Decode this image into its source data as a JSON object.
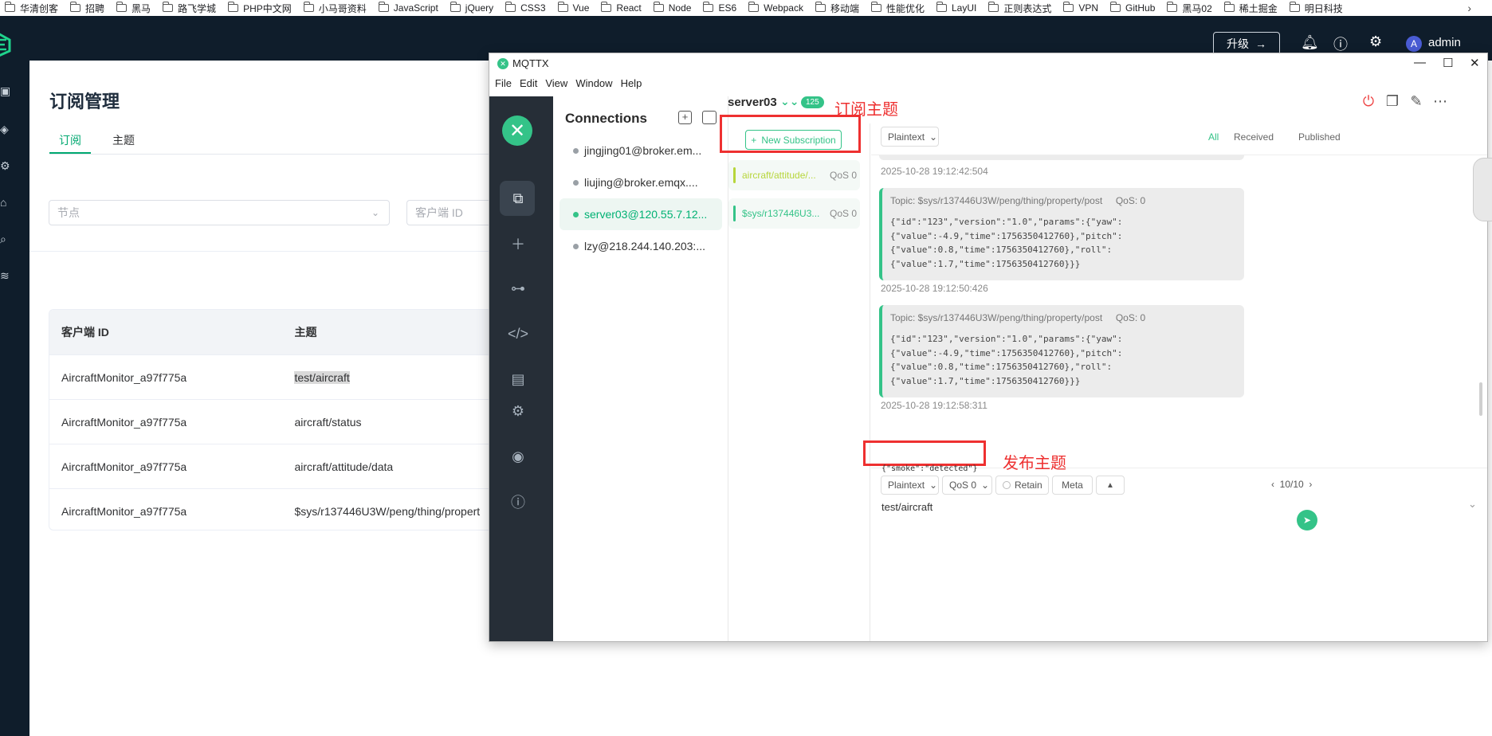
{
  "bookmarks": [
    {
      "label": "华清创客"
    },
    {
      "label": "招聘"
    },
    {
      "label": "黑马"
    },
    {
      "label": "路飞学城"
    },
    {
      "label": "PHP中文网"
    },
    {
      "label": "小马哥资料"
    },
    {
      "label": "JavaScript"
    },
    {
      "label": "jQuery"
    },
    {
      "label": "CSS3"
    },
    {
      "label": "Vue"
    },
    {
      "label": "React"
    },
    {
      "label": "Node"
    },
    {
      "label": "ES6"
    },
    {
      "label": "Webpack"
    },
    {
      "label": "移动端"
    },
    {
      "label": "性能优化"
    },
    {
      "label": "LayUI"
    },
    {
      "label": "正则表达式"
    },
    {
      "label": "VPN"
    },
    {
      "label": "GitHub"
    },
    {
      "label": "黑马02"
    },
    {
      "label": "稀土掘金"
    },
    {
      "label": "明日科技"
    }
  ],
  "emqx": {
    "header": {
      "upgrade_label": "升级",
      "avatar_letter": "A",
      "user_name": "admin"
    },
    "page_title": "订阅管理",
    "tabs": [
      {
        "label": "订阅"
      },
      {
        "label": "主题"
      }
    ],
    "filters": {
      "node_placeholder": "节点",
      "clientid_placeholder": "客户端 ID"
    },
    "table": {
      "columns": [
        "客户端 ID",
        "主题"
      ],
      "rows": [
        {
          "client_id": "AircraftMonitor_a97f775a",
          "topic": "test/aircraft"
        },
        {
          "client_id": "AircraftMonitor_a97f775a",
          "topic": "aircraft/status"
        },
        {
          "client_id": "AircraftMonitor_a97f775a",
          "topic": "aircraft/attitude/data"
        },
        {
          "client_id": "AircraftMonitor_a97f775a",
          "topic": "$sys/r137446U3W/peng/thing/propert"
        }
      ]
    }
  },
  "mqttx": {
    "window_title": "MQTTX",
    "menu": [
      "File",
      "Edit",
      "View",
      "Window",
      "Help"
    ],
    "connections_title": "Connections",
    "connections": [
      {
        "name": "jingjing01@broker.em...",
        "active": false
      },
      {
        "name": "liujing@broker.emqx....",
        "active": false
      },
      {
        "name": "server03@120.55.7.12...",
        "active": true
      },
      {
        "name": "lzy@218.244.140.203:...",
        "active": false
      }
    ],
    "current": {
      "name": "server03",
      "message_count": "125"
    },
    "annotations": {
      "subscribe": "订阅主题",
      "publish": "发布主题"
    },
    "new_subscription_label": "New Subscription",
    "subscriptions": [
      {
        "topic": "aircraft/attitude/...",
        "qos": "QoS 0",
        "color": "#b7d63b"
      },
      {
        "topic": "$sys/r137446U3...",
        "qos": "QoS 0",
        "color": "#34c388"
      }
    ],
    "format": "Plaintext",
    "filter_tabs": {
      "all": "All",
      "received": "Received",
      "published": "Published"
    },
    "messages": [
      {
        "time": "2025-10-28 19:12:42:504"
      },
      {
        "topic": "Topic: $sys/r137446U3W/peng/thing/property/post",
        "qos": "QoS: 0",
        "payload": "{\"id\":\"123\",\"version\":\"1.0\",\"params\":{\"yaw\":\n{\"value\":-4.9,\"time\":1756350412760},\"pitch\":\n{\"value\":0.8,\"time\":1756350412760},\"roll\":\n{\"value\":1.7,\"time\":1756350412760}}}",
        "time": "2025-10-28 19:12:50:426"
      },
      {
        "topic": "Topic: $sys/r137446U3W/peng/thing/property/post",
        "qos": "QoS: 0",
        "payload": "{\"id\":\"123\",\"version\":\"1.0\",\"params\":{\"yaw\":\n{\"value\":-4.9,\"time\":1756350412760},\"pitch\":\n{\"value\":0.8,\"time\":1756350412760},\"roll\":\n{\"value\":1.7,\"time\":1756350412760}}}",
        "time": "2025-10-28 19:12:58:311"
      }
    ],
    "publish": {
      "format": "Plaintext",
      "qos": "QoS 0",
      "retain_label": "Retain",
      "meta_label": "Meta",
      "page": "10/10",
      "topic": "test/aircraft",
      "payload": "{\"smoke\":\"detected\"}"
    },
    "colors": {
      "accent": "#34c388",
      "annotation": "#ee3030",
      "rail": "#262e37"
    }
  }
}
